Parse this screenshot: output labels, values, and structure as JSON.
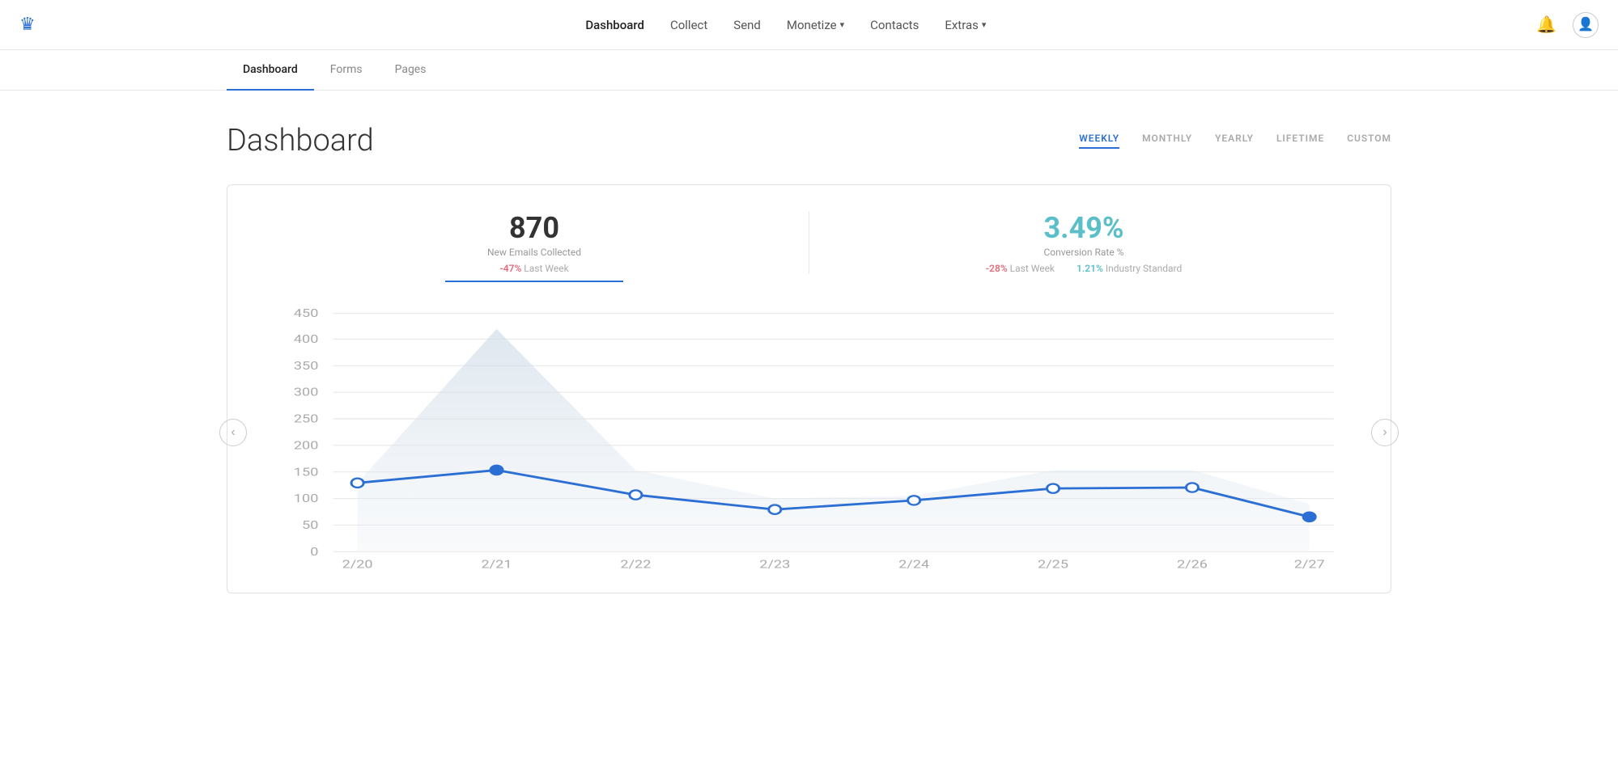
{
  "nav": {
    "logo": "♛",
    "links": [
      {
        "label": "Dashboard",
        "active": true
      },
      {
        "label": "Collect",
        "active": false
      },
      {
        "label": "Send",
        "active": false
      },
      {
        "label": "Monetize",
        "active": false,
        "dropdown": true
      },
      {
        "label": "Contacts",
        "active": false
      },
      {
        "label": "Extras",
        "active": false,
        "dropdown": true
      }
    ]
  },
  "sub_nav": {
    "tabs": [
      {
        "label": "Dashboard",
        "active": true
      },
      {
        "label": "Forms",
        "active": false
      },
      {
        "label": "Pages",
        "active": false
      }
    ]
  },
  "dashboard": {
    "title": "Dashboard",
    "time_filters": [
      {
        "label": "WEEKLY",
        "active": true
      },
      {
        "label": "MONTHLY",
        "active": false
      },
      {
        "label": "YEARLY",
        "active": false
      },
      {
        "label": "LIFETIME",
        "active": false
      },
      {
        "label": "CUSTOM",
        "active": false
      }
    ],
    "stats": {
      "emails": {
        "number": "870",
        "label": "New Emails Collected",
        "change_pct": "-47%",
        "change_label": "Last Week"
      },
      "conversion": {
        "number": "3.49%",
        "label": "Conversion Rate %",
        "change_pct": "-28%",
        "change_label": "Last Week",
        "industry_pct": "1.21%",
        "industry_label": "Industry Standard"
      }
    },
    "chart": {
      "y_labels": [
        "0",
        "50",
        "100",
        "150",
        "200",
        "250",
        "300",
        "350",
        "400",
        "450"
      ],
      "x_labels": [
        "2/20",
        "2/21",
        "2/22",
        "2/23",
        "2/24",
        "2/25",
        "2/26",
        "2/27"
      ],
      "line_data": [
        130,
        155,
        107,
        80,
        97,
        120,
        122,
        65
      ],
      "area_data": [
        130,
        420,
        155,
        100,
        105,
        155,
        155,
        90
      ]
    }
  }
}
